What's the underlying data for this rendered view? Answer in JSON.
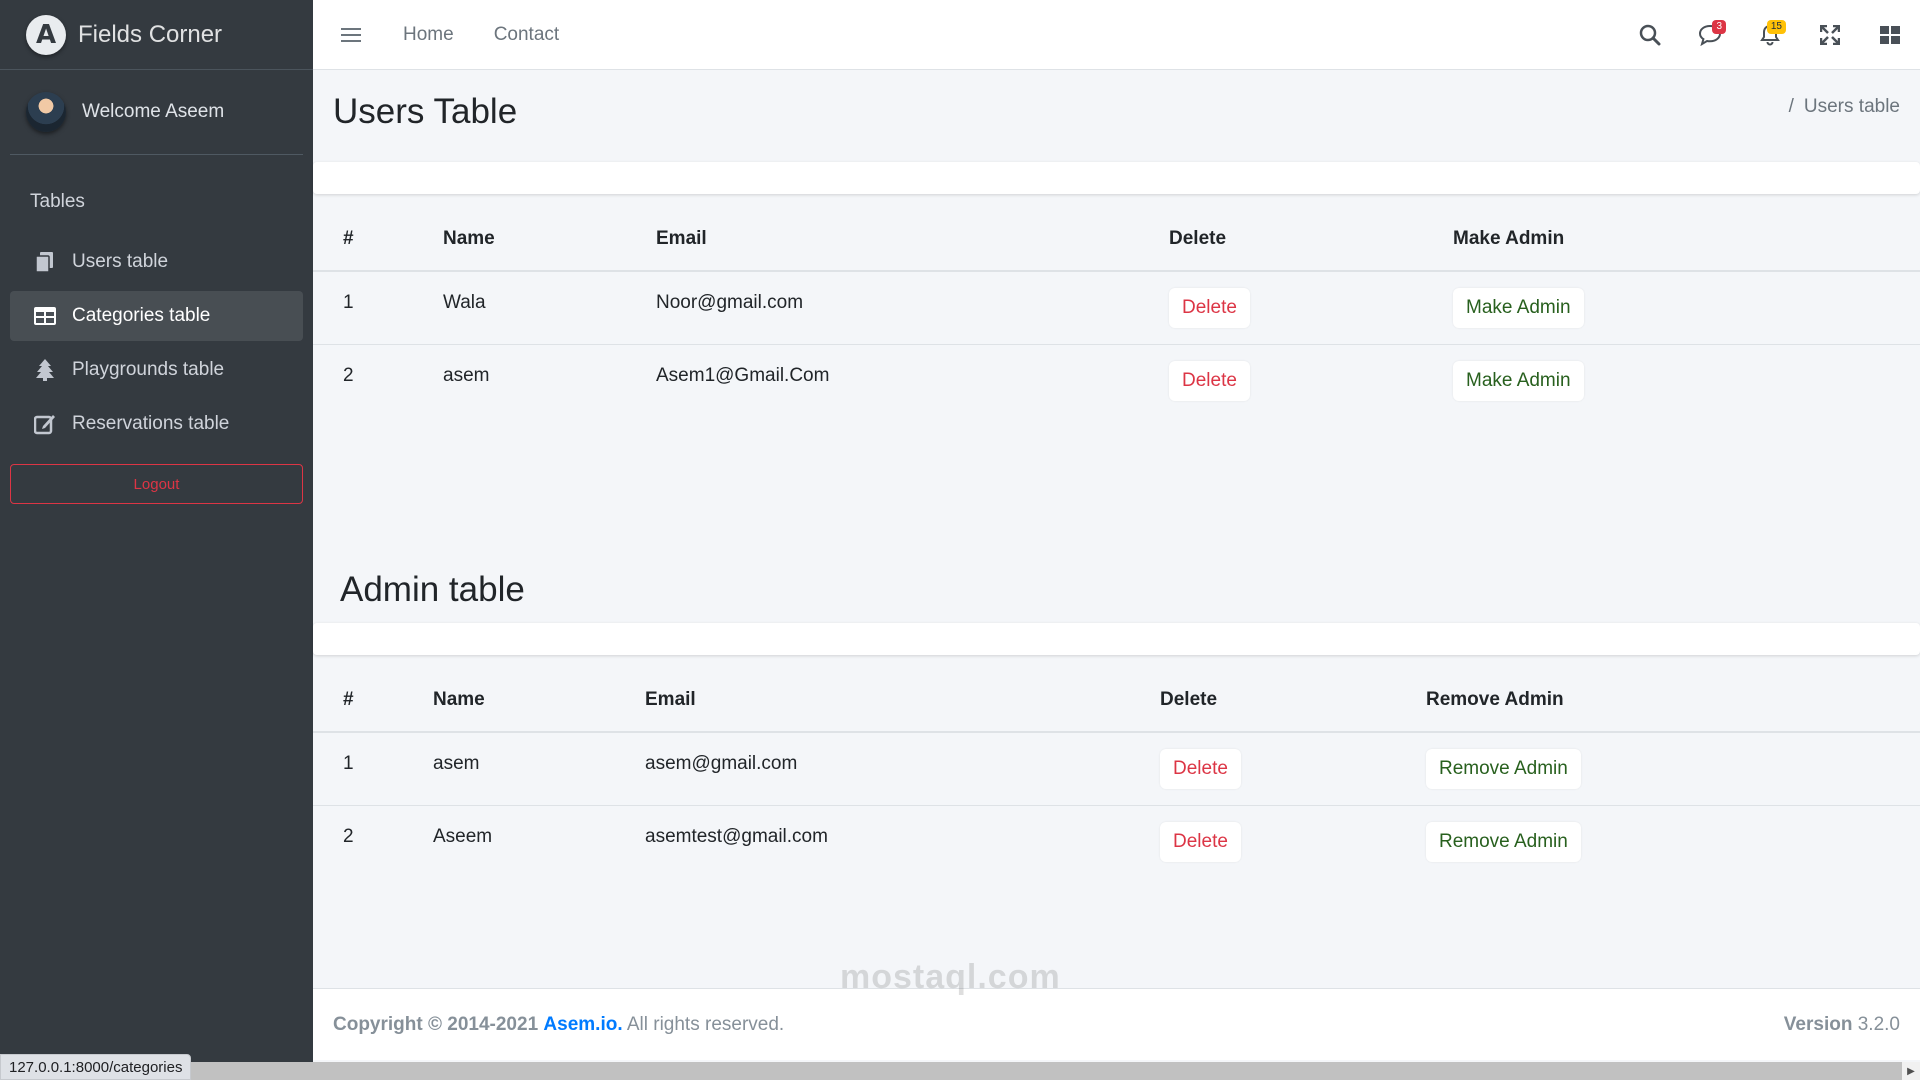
{
  "brand": {
    "name": "Fields Corner",
    "logo_letter": "A"
  },
  "user": {
    "welcome": "Welcome Aseem"
  },
  "sidebar": {
    "header": "Tables",
    "items": [
      {
        "label": "Users table",
        "icon": "copy-icon",
        "active": false
      },
      {
        "label": "Categories table",
        "icon": "table-icon",
        "active": true
      },
      {
        "label": "Playgrounds table",
        "icon": "tree-icon",
        "active": false
      },
      {
        "label": "Reservations table",
        "icon": "edit-icon",
        "active": false
      }
    ],
    "logout_label": "Logout"
  },
  "navbar": {
    "links": [
      "Home",
      "Contact"
    ],
    "messages_badge": "3",
    "notifications_badge": "15"
  },
  "page": {
    "title": "Users Table",
    "breadcrumb_sep": "/",
    "breadcrumb_current": "Users table"
  },
  "users_table": {
    "headers": [
      "#",
      "Name",
      "Email",
      "Delete",
      "Make Admin"
    ],
    "rows": [
      {
        "num": "1",
        "name": "Wala",
        "email": "Noor@gmail.com",
        "delete_label": "Delete",
        "action_label": "Make Admin"
      },
      {
        "num": "2",
        "name": "asem",
        "email": "Asem1@Gmail.Com",
        "delete_label": "Delete",
        "action_label": "Make Admin"
      }
    ]
  },
  "admin_section": {
    "title": "Admin table"
  },
  "admin_table": {
    "headers": [
      "#",
      "Name",
      "Email",
      "Delete",
      "Remove Admin"
    ],
    "rows": [
      {
        "num": "1",
        "name": "asem",
        "email": "asem@gmail.com",
        "delete_label": "Delete",
        "action_label": "Remove Admin"
      },
      {
        "num": "2",
        "name": "Aseem",
        "email": "asemtest@gmail.com",
        "delete_label": "Delete",
        "action_label": "Remove Admin"
      }
    ]
  },
  "footer": {
    "copyright_prefix": "Copyright © 2014-2021",
    "link_text": "Asem.io.",
    "rights": "All rights reserved.",
    "version_label": "Version",
    "version_number": "3.2.0"
  },
  "statusbar": {
    "url": "127.0.0.1:8000/categories"
  },
  "watermark": "mostaql.com",
  "colors": {
    "sidebar_bg": "#343a40",
    "danger": "#dc3545",
    "success_text": "#28601e",
    "link": "#007bff"
  }
}
